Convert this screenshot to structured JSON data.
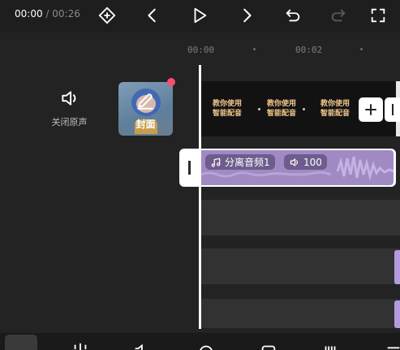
{
  "player": {
    "current_time": "00:00",
    "separator": " / ",
    "total_time": "00:26"
  },
  "toolbar": {
    "icons": [
      "keyframe-icon",
      "prev-icon",
      "play-icon",
      "next-icon",
      "undo-icon",
      "redo-icon",
      "fullscreen-icon"
    ]
  },
  "ruler": {
    "labels": [
      "00:00",
      "00:02"
    ]
  },
  "left_panel": {
    "mute_label": "关闭原声",
    "cover_label": "封面"
  },
  "video_track": {
    "frame_text": [
      "教你使用\n智能配音",
      "教你使用\n智能配音",
      "教你使用\n智能配音"
    ]
  },
  "audio_track": {
    "name": "分离音频1",
    "volume": "100"
  },
  "colors": {
    "background": "#232323",
    "audio_clip": "#a08ac4",
    "accent_dot": "#ff4d6d",
    "frame_text": "#f1c68b"
  }
}
